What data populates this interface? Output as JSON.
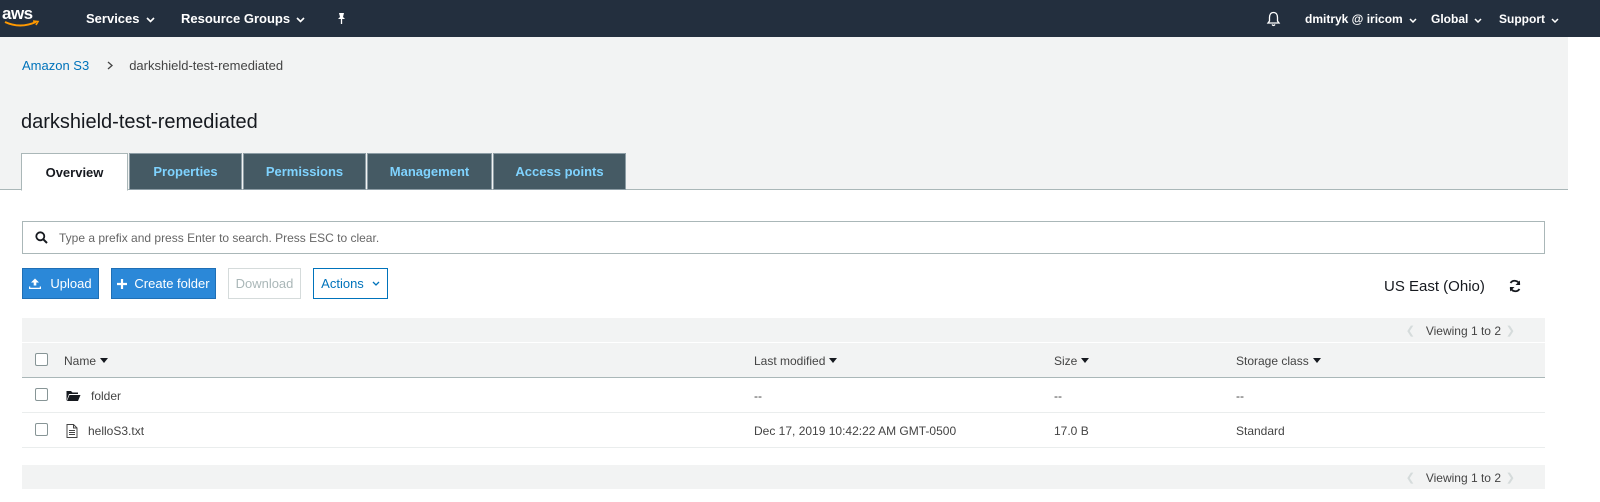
{
  "nav": {
    "logo_text": "aws",
    "services": "Services",
    "resource_groups": "Resource Groups",
    "account": "dmitryk @ iricom",
    "region_menu": "Global",
    "support": "Support"
  },
  "breadcrumb": {
    "root": "Amazon S3",
    "current": "darkshield-test-remediated"
  },
  "page_title": "darkshield-test-remediated",
  "tabs": [
    {
      "label": "Overview",
      "active": true
    },
    {
      "label": "Properties",
      "active": false
    },
    {
      "label": "Permissions",
      "active": false
    },
    {
      "label": "Management",
      "active": false
    },
    {
      "label": "Access points",
      "active": false
    }
  ],
  "search": {
    "placeholder": "Type a prefix and press Enter to search. Press ESC to clear.",
    "value": ""
  },
  "toolbar": {
    "upload": "Upload",
    "create_folder": "Create folder",
    "download": "Download",
    "actions": "Actions"
  },
  "region": "US East (Ohio)",
  "viewing": "Viewing 1 to 2",
  "table": {
    "columns": [
      "Name",
      "Last modified",
      "Size",
      "Storage class"
    ],
    "rows": [
      {
        "name": "folder",
        "type": "folder",
        "last_modified": "--",
        "size": "--",
        "storage_class": "--"
      },
      {
        "name": "helloS3.txt",
        "type": "file",
        "last_modified": "Dec 17, 2019 10:42:22 AM GMT-0500",
        "size": "17.0 B",
        "storage_class": "Standard"
      }
    ]
  },
  "colors": {
    "nav_bg": "#232f3e",
    "link": "#0073bb",
    "primary_button": "#2b88d8",
    "tab_bg": "#455a64",
    "tab_text": "#7fd3ff"
  }
}
